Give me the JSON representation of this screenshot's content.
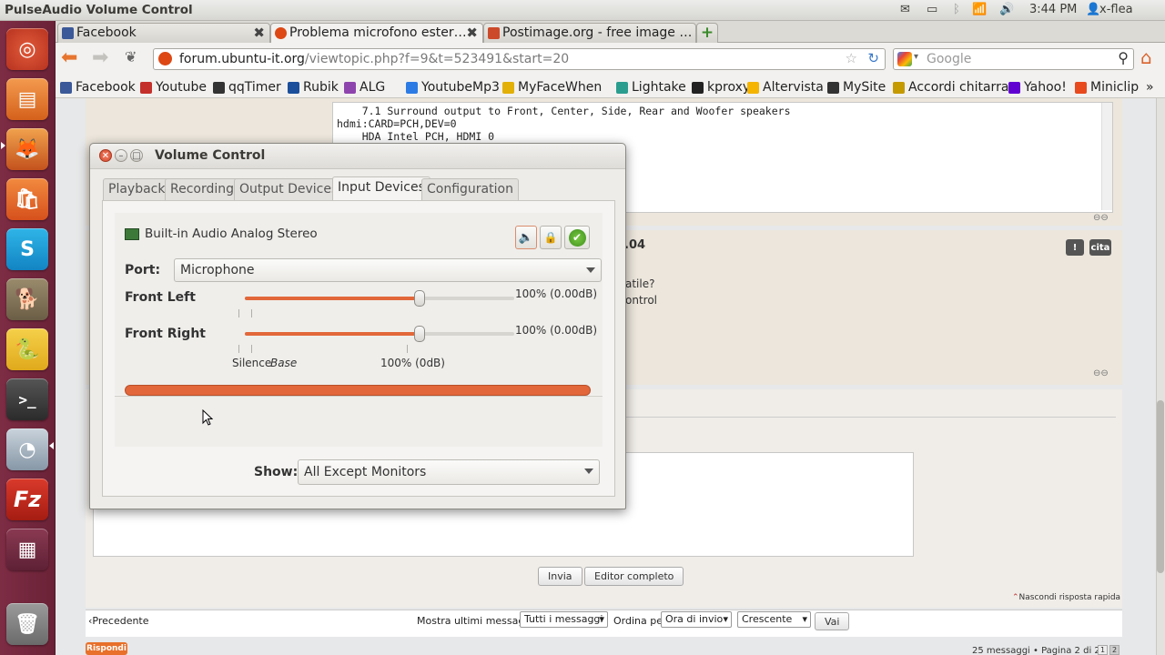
{
  "top_panel": {
    "app_title": "PulseAudio Volume Control",
    "time": "3:44 PM",
    "user": "x-flea"
  },
  "browser": {
    "tabs": [
      {
        "label": "Facebook",
        "active": false
      },
      {
        "label": "Problema microfono ester…",
        "active": true
      },
      {
        "label": "Postimage.org - free image …",
        "active": false
      }
    ],
    "url_domain": "forum.ubuntu-it.org",
    "url_prefix": "",
    "url_path": "/viewtopic.php?f=9&t=523491&start=20",
    "search_placeholder": "Google",
    "bookmarks": [
      {
        "label": "Facebook",
        "color": "#3b5998"
      },
      {
        "label": "Youtube",
        "color": "#c4302b"
      },
      {
        "label": "qqTimer",
        "color": "#333333"
      },
      {
        "label": "Rubik",
        "color": "#1b4f9c"
      },
      {
        "label": "ALG",
        "color": "#8e44ad"
      },
      {
        "label": "YoutubeMp3",
        "color": "#2c7be5"
      },
      {
        "label": "MyFaceWhen",
        "color": "#e2b007"
      },
      {
        "label": "Lightake",
        "color": "#2a9d8f"
      },
      {
        "label": "kproxy",
        "color": "#222222"
      },
      {
        "label": "Altervista",
        "color": "#f4b400"
      },
      {
        "label": "MySite",
        "color": "#333333"
      },
      {
        "label": "Accordi chitarra",
        "color": "#c49a00"
      },
      {
        "label": "Yahoo!",
        "color": "#6001d2"
      },
      {
        "label": "Miniclip",
        "color": "#e8491d"
      }
    ]
  },
  "page": {
    "code_lines": [
      "    7.1 Surround output to Front, Center, Side, Rear and Woofer speakers",
      "hdmi:CARD=PCH,DEV=0",
      "    HDA Intel PCH, HDMI 0"
    ],
    "post_fragment_title": ".04",
    "post_fragment_line1": "atile?",
    "post_fragment_line2": "ontrol",
    "btn_report": "!",
    "btn_quote": "cita",
    "btn_send": "Invia",
    "btn_full_editor": "Editor completo",
    "hide_quick_reply": "Nascondi risposta rapida",
    "prev_link": "Precedente",
    "show_last_label": "Mostra ultimi messaggi:",
    "show_last_value": "Tutti i messaggi",
    "order_by_label": "Ordina per",
    "order_by_value": "Ora di invio",
    "order_dir_value": "Crescente",
    "go_button": "Vai",
    "reply_button": "Rispondi",
    "pagination_text": "25 messaggi • Pagina 2 di 2 •",
    "page_1": "1",
    "page_2": "2"
  },
  "dialog": {
    "title": "Volume Control",
    "tabs": [
      "Playback",
      "Recording",
      "Output Devices",
      "Input Devices",
      "Configuration"
    ],
    "active_tab": "Input Devices",
    "device_name": "Built-in Audio Analog Stereo",
    "port_label": "Port:",
    "port_value": "Microphone",
    "channels": [
      {
        "name": "Front Left",
        "value_text": "100% (0.00dB)",
        "level": 0.65
      },
      {
        "name": "Front Right",
        "value_text": "100% (0.00dB)",
        "level": 0.65
      }
    ],
    "scale_silence": "Silence",
    "scale_base": "Base",
    "scale_100": "100% (0dB)",
    "peak_level": 1.0,
    "show_label": "Show:",
    "show_value": "All Except Monitors"
  },
  "colors": {
    "accent": "#e2673a",
    "launcher": "#7d2c44"
  }
}
